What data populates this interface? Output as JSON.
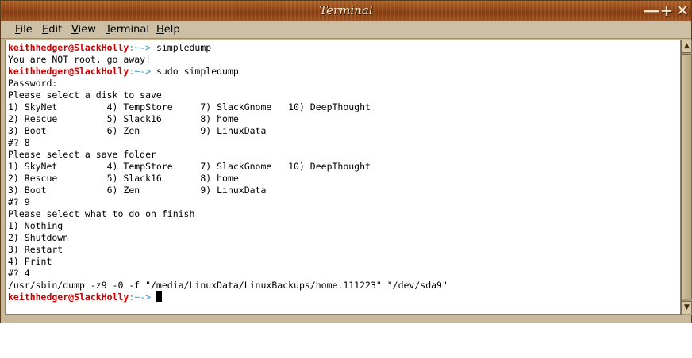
{
  "window": {
    "title": "Terminal",
    "controls": {
      "minimize": "—",
      "maximize": "+",
      "close": "✕"
    }
  },
  "menu": [
    "File",
    "Edit",
    "View",
    "Terminal",
    "Help"
  ],
  "menu_mnemonics": [
    "F",
    "E",
    "V",
    "T",
    "H"
  ],
  "prompt": {
    "user": "keithhedger@SlackHolly",
    "sep": ":~-> "
  },
  "terminal": {
    "lines": [
      {
        "type": "prompt",
        "cmd": "simpledump"
      },
      {
        "type": "text",
        "text": "You are NOT root, go away!"
      },
      {
        "type": "prompt",
        "cmd": "sudo simpledump"
      },
      {
        "type": "text",
        "text": "Password:"
      },
      {
        "type": "text",
        "text": "Please select a disk to save"
      },
      {
        "type": "text",
        "text": "1) SkyNet         4) TempStore     7) SlackGnome   10) DeepThought"
      },
      {
        "type": "text",
        "text": "2) Rescue         5) Slack16       8) home"
      },
      {
        "type": "text",
        "text": "3) Boot           6) Zen           9) LinuxData"
      },
      {
        "type": "text",
        "text": "#? 8"
      },
      {
        "type": "text",
        "text": "Please select a save folder"
      },
      {
        "type": "text",
        "text": "1) SkyNet         4) TempStore     7) SlackGnome   10) DeepThought"
      },
      {
        "type": "text",
        "text": "2) Rescue         5) Slack16       8) home"
      },
      {
        "type": "text",
        "text": "3) Boot           6) Zen           9) LinuxData"
      },
      {
        "type": "text",
        "text": "#? 9"
      },
      {
        "type": "text",
        "text": "Please select what to do on finish"
      },
      {
        "type": "text",
        "text": "1) Nothing"
      },
      {
        "type": "text",
        "text": "2) Shutdown"
      },
      {
        "type": "text",
        "text": "3) Restart"
      },
      {
        "type": "text",
        "text": "4) Print"
      },
      {
        "type": "text",
        "text": "#? 4"
      },
      {
        "type": "text",
        "text": "/usr/sbin/dump -z9 -0 -f \"/media/LinuxData/LinuxBackups/home.111223\" \"/dev/sda9\""
      },
      {
        "type": "prompt",
        "cmd": "",
        "cursor": true
      }
    ]
  },
  "colors": {
    "prompt_user": "#cc0000",
    "prompt_sep": "#3a8fbf",
    "titlebar": "#9c4f1c"
  }
}
